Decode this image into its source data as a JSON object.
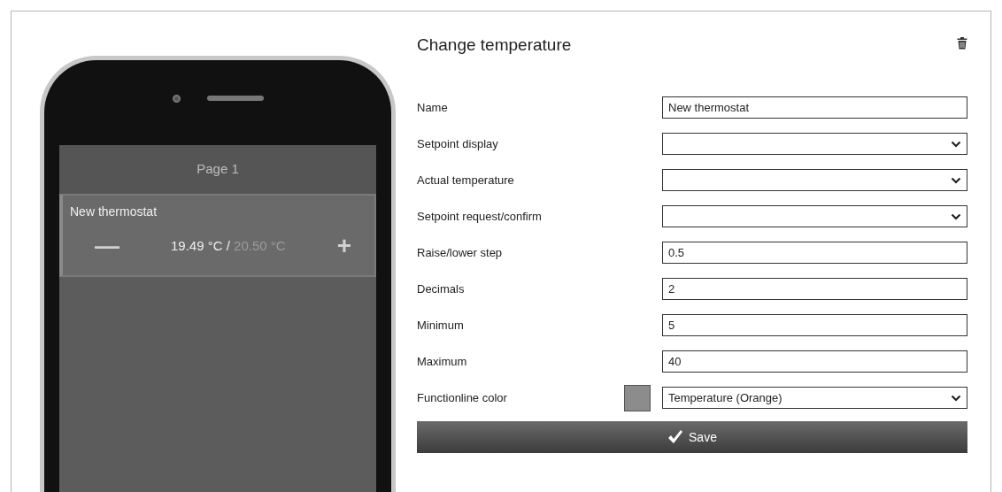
{
  "phone": {
    "page_title": "Page 1",
    "tile": {
      "name": "New thermostat",
      "actual": "19.49 °C",
      "separator": "/",
      "setpoint": "20.50 °C",
      "minus": "—",
      "plus": "+"
    }
  },
  "form": {
    "title": "Change temperature",
    "fields": [
      {
        "label": "Name",
        "kind": "text",
        "value": "New thermostat"
      },
      {
        "label": "Setpoint display",
        "kind": "select"
      },
      {
        "label": "Actual temperature",
        "kind": "select"
      },
      {
        "label": "Setpoint request/confirm",
        "kind": "select"
      },
      {
        "label": "Raise/lower step",
        "kind": "text",
        "value": "0.5"
      },
      {
        "label": "Decimals",
        "kind": "text",
        "value": "2"
      },
      {
        "label": "Minimum",
        "kind": "text",
        "value": "5"
      },
      {
        "label": "Maximum",
        "kind": "text",
        "value": "40"
      },
      {
        "label": "Functionline color",
        "kind": "select",
        "value": "Temperature (Orange)",
        "color": "#8c8c8c"
      }
    ],
    "save": "Save"
  }
}
